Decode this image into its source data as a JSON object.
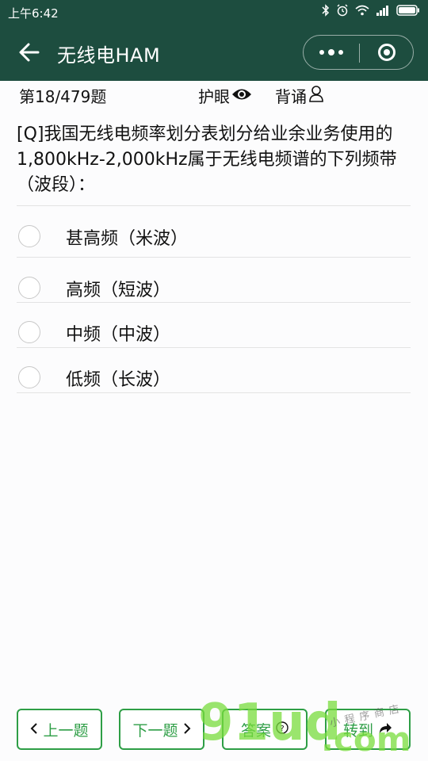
{
  "status_bar": {
    "time": "上午6:42"
  },
  "nav": {
    "title": "无线电HAM"
  },
  "info": {
    "index": "第18/479题",
    "eye_label": "护眼",
    "recite_label": "背诵"
  },
  "question": {
    "text": "[Q]我国无线电频率划分表划分给业余业务使用的1,800kHz-2,000kHz属于无线电频谱的下列频带（波段）："
  },
  "options": [
    {
      "label": "甚高频（米波）"
    },
    {
      "label": "高频（短波）"
    },
    {
      "label": "中频（中波）"
    },
    {
      "label": "低频（长波）"
    }
  ],
  "footer": {
    "prev_label": "上一题",
    "next_label": "下一题",
    "answer_label": "答案",
    "goto_label": "转到"
  },
  "watermark": {
    "text1": "91ud",
    "text2": ".com",
    "text3": "小程序商店"
  },
  "colors": {
    "nav_bg": "#1d4d3f",
    "accent": "#2e9e46"
  }
}
